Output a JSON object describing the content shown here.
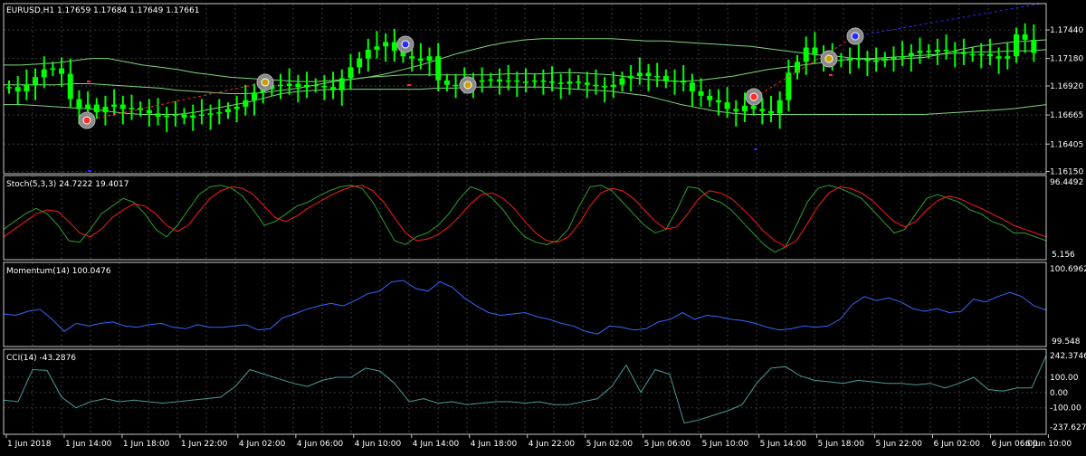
{
  "colors": {
    "background": "#000000",
    "grid": "#3a3a3a",
    "frame": "#c8c8c8",
    "text": "#ffffff",
    "candle": "#00ff00",
    "band": "#7fd67f",
    "stoch_main": "#2e9e2e",
    "stoch_signal": "#ff1a1a",
    "momentum": "#3366ff",
    "cci": "#4a9a9a",
    "trend_red": "#ff2a2a",
    "trend_blue": "#2a2aff"
  },
  "chart_data": [
    {
      "type": "candlestick",
      "title": "EURUSD,H1  1.17659 1.17684 1.17649 1.17661",
      "ylim": [
        1.1613,
        1.1768
      ],
      "yticks": [
        1.1615,
        1.164,
        1.16665,
        1.1693,
        1.1718,
        1.1744
      ],
      "ytick_labels": [
        "1.16150",
        "1.16405",
        "1.16665",
        "1.16920",
        "1.17180",
        "1.17440"
      ],
      "xtick_labels": [
        "1 Jun 2018",
        "1 Jun 14:00",
        "1 Jun 18:00",
        "1 Jun 22:00",
        "4 Jun 02:00",
        "4 Jun 06:00",
        "4 Jun 10:00",
        "4 Jun 14:00",
        "4 Jun 18:00",
        "4 Jun 22:00",
        "5 Jun 02:00",
        "5 Jun 06:00",
        "5 Jun 10:00",
        "5 Jun 14:00",
        "5 Jun 18:00",
        "5 Jun 22:00",
        "6 Jun 02:00",
        "6 Jun 06:00",
        "6 Jun 10:00"
      ],
      "close": [
        1.1692,
        1.1688,
        1.1694,
        1.1701,
        1.1708,
        1.1709,
        1.1704,
        1.1681,
        1.1672,
        1.1676,
        1.1669,
        1.1674,
        1.1676,
        1.1672,
        1.1673,
        1.1671,
        1.1668,
        1.1665,
        1.1666,
        1.1667,
        1.1664,
        1.1666,
        1.1667,
        1.1668,
        1.1669,
        1.1672,
        1.1674,
        1.168,
        1.1687,
        1.169,
        1.1694,
        1.1693,
        1.1695,
        1.1692,
        1.1694,
        1.1693,
        1.1692,
        1.1689,
        1.17,
        1.171,
        1.1718,
        1.1726,
        1.1729,
        1.1733,
        1.1725,
        1.172,
        1.1718,
        1.1716,
        1.172,
        1.1698,
        1.1694,
        1.1694,
        1.1696,
        1.1697,
        1.1698,
        1.1699,
        1.1697,
        1.1698,
        1.1697,
        1.1697,
        1.1698,
        1.1697,
        1.1696,
        1.1695,
        1.1697,
        1.1696,
        1.1694,
        1.1693,
        1.1692,
        1.1694,
        1.17,
        1.1702,
        1.1705,
        1.1702,
        1.1702,
        1.1697,
        1.1698,
        1.1696,
        1.1688,
        1.1684,
        1.168,
        1.1678,
        1.1672,
        1.167,
        1.1675,
        1.1672,
        1.167,
        1.1668,
        1.168,
        1.1705,
        1.1715,
        1.1728,
        1.1722,
        1.172,
        1.1717,
        1.1716,
        1.1718,
        1.1717,
        1.1716,
        1.1716,
        1.1718,
        1.1719,
        1.172,
        1.1723,
        1.1725,
        1.1724,
        1.1726,
        1.1725,
        1.1724,
        1.1722,
        1.1721,
        1.1722,
        1.172,
        1.1718,
        1.172,
        1.174,
        1.1735,
        1.1723
      ],
      "bands": {
        "upper": [
          1.1712,
          1.1712,
          1.1713,
          1.1714,
          1.1716,
          1.1718,
          1.1718,
          1.1715,
          1.1712,
          1.171,
          1.1708,
          1.1705,
          1.1703,
          1.1701,
          1.17,
          1.1699,
          1.1698,
          1.1697,
          1.1697,
          1.1698,
          1.1699,
          1.1701,
          1.1704,
          1.1708,
          1.1712,
          1.1717,
          1.1722,
          1.1726,
          1.173,
          1.1733,
          1.1735,
          1.1736,
          1.1736,
          1.1736,
          1.1736,
          1.1736,
          1.1735,
          1.1734,
          1.1734,
          1.1733,
          1.1732,
          1.1731,
          1.173,
          1.1729,
          1.1727,
          1.1725,
          1.1723,
          1.1721,
          1.172,
          1.1718,
          1.1717,
          1.1717,
          1.1718,
          1.1719,
          1.1722,
          1.1726,
          1.1729,
          1.1731,
          1.1733,
          1.1734,
          1.1735
        ],
        "middle": [
          1.1694,
          1.1694,
          1.1694,
          1.1694,
          1.1695,
          1.1695,
          1.1694,
          1.1693,
          1.1692,
          1.1691,
          1.1689,
          1.1688,
          1.1687,
          1.1686,
          1.1686,
          1.1687,
          1.1689,
          1.1691,
          1.1694,
          1.1697,
          1.1699,
          1.1701,
          1.1702,
          1.1703,
          1.1703,
          1.1703,
          1.1703,
          1.1703,
          1.1703,
          1.1704,
          1.1704,
          1.1704,
          1.1705,
          1.1705,
          1.1704,
          1.1703,
          1.1701,
          1.1699,
          1.1698,
          1.1697,
          1.1698,
          1.17,
          1.1702,
          1.1705,
          1.1708,
          1.171,
          1.1712,
          1.1714,
          1.1716,
          1.1718,
          1.1718,
          1.1719,
          1.172,
          1.1721,
          1.1722,
          1.1723,
          1.1724,
          1.1724,
          1.1725,
          1.1725,
          1.1726
        ],
        "lower": [
          1.1676,
          1.1676,
          1.1675,
          1.1674,
          1.1673,
          1.1672,
          1.167,
          1.1668,
          1.1667,
          1.1667,
          1.1667,
          1.1669,
          1.1672,
          1.1675,
          1.1678,
          1.1682,
          1.1686,
          1.1688,
          1.1689,
          1.169,
          1.169,
          1.169,
          1.169,
          1.169,
          1.169,
          1.1691,
          1.1691,
          1.1692,
          1.1692,
          1.1692,
          1.1692,
          1.1692,
          1.1691,
          1.169,
          1.1689,
          1.1688,
          1.1686,
          1.1684,
          1.168,
          1.1676,
          1.1673,
          1.167,
          1.1668,
          1.1667,
          1.1667,
          1.1667,
          1.1667,
          1.1667,
          1.1667,
          1.1667,
          1.1667,
          1.1667,
          1.1667,
          1.1667,
          1.1668,
          1.1669,
          1.167,
          1.1671,
          1.1672,
          1.1674,
          1.1676
        ]
      }
    },
    {
      "type": "line",
      "title": "Stoch(5,3,3) 24.7222 19.4017",
      "ylim": [
        0,
        100
      ],
      "ytick_labels": [
        "96.4492",
        "5.156"
      ],
      "series": [
        {
          "values": [
            35,
            45,
            55,
            62,
            55,
            40,
            20,
            18,
            35,
            55,
            65,
            75,
            70,
            55,
            35,
            25,
            40,
            60,
            80,
            90,
            92,
            88,
            78,
            60,
            40,
            45,
            55,
            65,
            70,
            78,
            85,
            90,
            92,
            88,
            70,
            45,
            20,
            15,
            25,
            30,
            40,
            55,
            75,
            90,
            85,
            75,
            60,
            40,
            25,
            18,
            15,
            20,
            35,
            65,
            90,
            92,
            85,
            70,
            55,
            40,
            30,
            35,
            60,
            90,
            88,
            75,
            70,
            60,
            45,
            30,
            15,
            5,
            12,
            40,
            70,
            88,
            92,
            88,
            82,
            75,
            60,
            45,
            30,
            35,
            55,
            75,
            80,
            75,
            70,
            60,
            55,
            45,
            40,
            30,
            30,
            25,
            20
          ]
        },
        {
          "values": [
            25,
            35,
            45,
            55,
            60,
            58,
            45,
            30,
            25,
            35,
            50,
            60,
            68,
            65,
            55,
            40,
            32,
            40,
            58,
            75,
            85,
            90,
            88,
            80,
            65,
            50,
            45,
            52,
            62,
            70,
            78,
            85,
            90,
            92,
            85,
            70,
            50,
            30,
            20,
            22,
            28,
            38,
            52,
            68,
            80,
            82,
            75,
            62,
            45,
            30,
            20,
            18,
            25,
            42,
            65,
            82,
            88,
            85,
            75,
            60,
            45,
            35,
            38,
            55,
            75,
            85,
            82,
            75,
            62,
            48,
            32,
            20,
            12,
            20,
            42,
            65,
            82,
            90,
            88,
            82,
            72,
            58,
            45,
            38,
            45,
            60,
            72,
            78,
            75,
            68,
            62,
            55,
            48,
            40,
            35,
            30,
            25
          ]
        }
      ]
    },
    {
      "type": "line",
      "title": "Momentum(14) 100.0476",
      "ylim": [
        99.548,
        100.6962
      ],
      "ytick_labels": [
        "100.6962",
        "99.548"
      ],
      "values": [
        99.98,
        99.96,
        100.02,
        100.05,
        99.9,
        99.72,
        99.84,
        99.8,
        99.84,
        99.86,
        99.8,
        99.78,
        99.82,
        99.84,
        99.78,
        99.76,
        99.82,
        99.78,
        99.78,
        99.8,
        99.82,
        99.74,
        99.76,
        99.92,
        99.98,
        100.05,
        100.1,
        100.14,
        100.1,
        100.18,
        100.28,
        100.32,
        100.46,
        100.48,
        100.36,
        100.32,
        100.46,
        100.38,
        100.22,
        100.1,
        100.0,
        99.96,
        99.98,
        100.0,
        99.94,
        99.9,
        99.84,
        99.8,
        99.72,
        99.68,
        99.8,
        99.78,
        99.74,
        99.76,
        99.86,
        99.9,
        100.0,
        99.9,
        99.96,
        99.94,
        99.9,
        99.88,
        99.84,
        99.78,
        99.74,
        99.76,
        99.8,
        99.78,
        99.8,
        99.9,
        100.12,
        100.24,
        100.18,
        100.22,
        100.16,
        100.06,
        100.02,
        100.06,
        100.0,
        100.02,
        100.2,
        100.16,
        100.24,
        100.3,
        100.24,
        100.1,
        100.04
      ]
    },
    {
      "type": "line",
      "title": "CCI(14) -43.2876",
      "ylim": [
        -250,
        260
      ],
      "ytick_labels": [
        "242.3746",
        "100.00",
        "0.00",
        "-100.00",
        "-237.6271"
      ],
      "values": [
        -50,
        -60,
        150,
        145,
        -30,
        -100,
        -60,
        -40,
        -60,
        -50,
        -60,
        -70,
        -60,
        -50,
        -40,
        -30,
        40,
        150,
        120,
        90,
        60,
        40,
        80,
        100,
        100,
        160,
        140,
        60,
        -60,
        -40,
        -70,
        -60,
        -80,
        -70,
        -60,
        -60,
        -70,
        -60,
        -80,
        -80,
        -60,
        -40,
        40,
        180,
        0,
        150,
        120,
        -200,
        -180,
        -150,
        -120,
        -80,
        60,
        160,
        170,
        110,
        80,
        70,
        60,
        80,
        70,
        60,
        60,
        50,
        60,
        30,
        60,
        100,
        20,
        10,
        30,
        30,
        243
      ]
    }
  ]
}
